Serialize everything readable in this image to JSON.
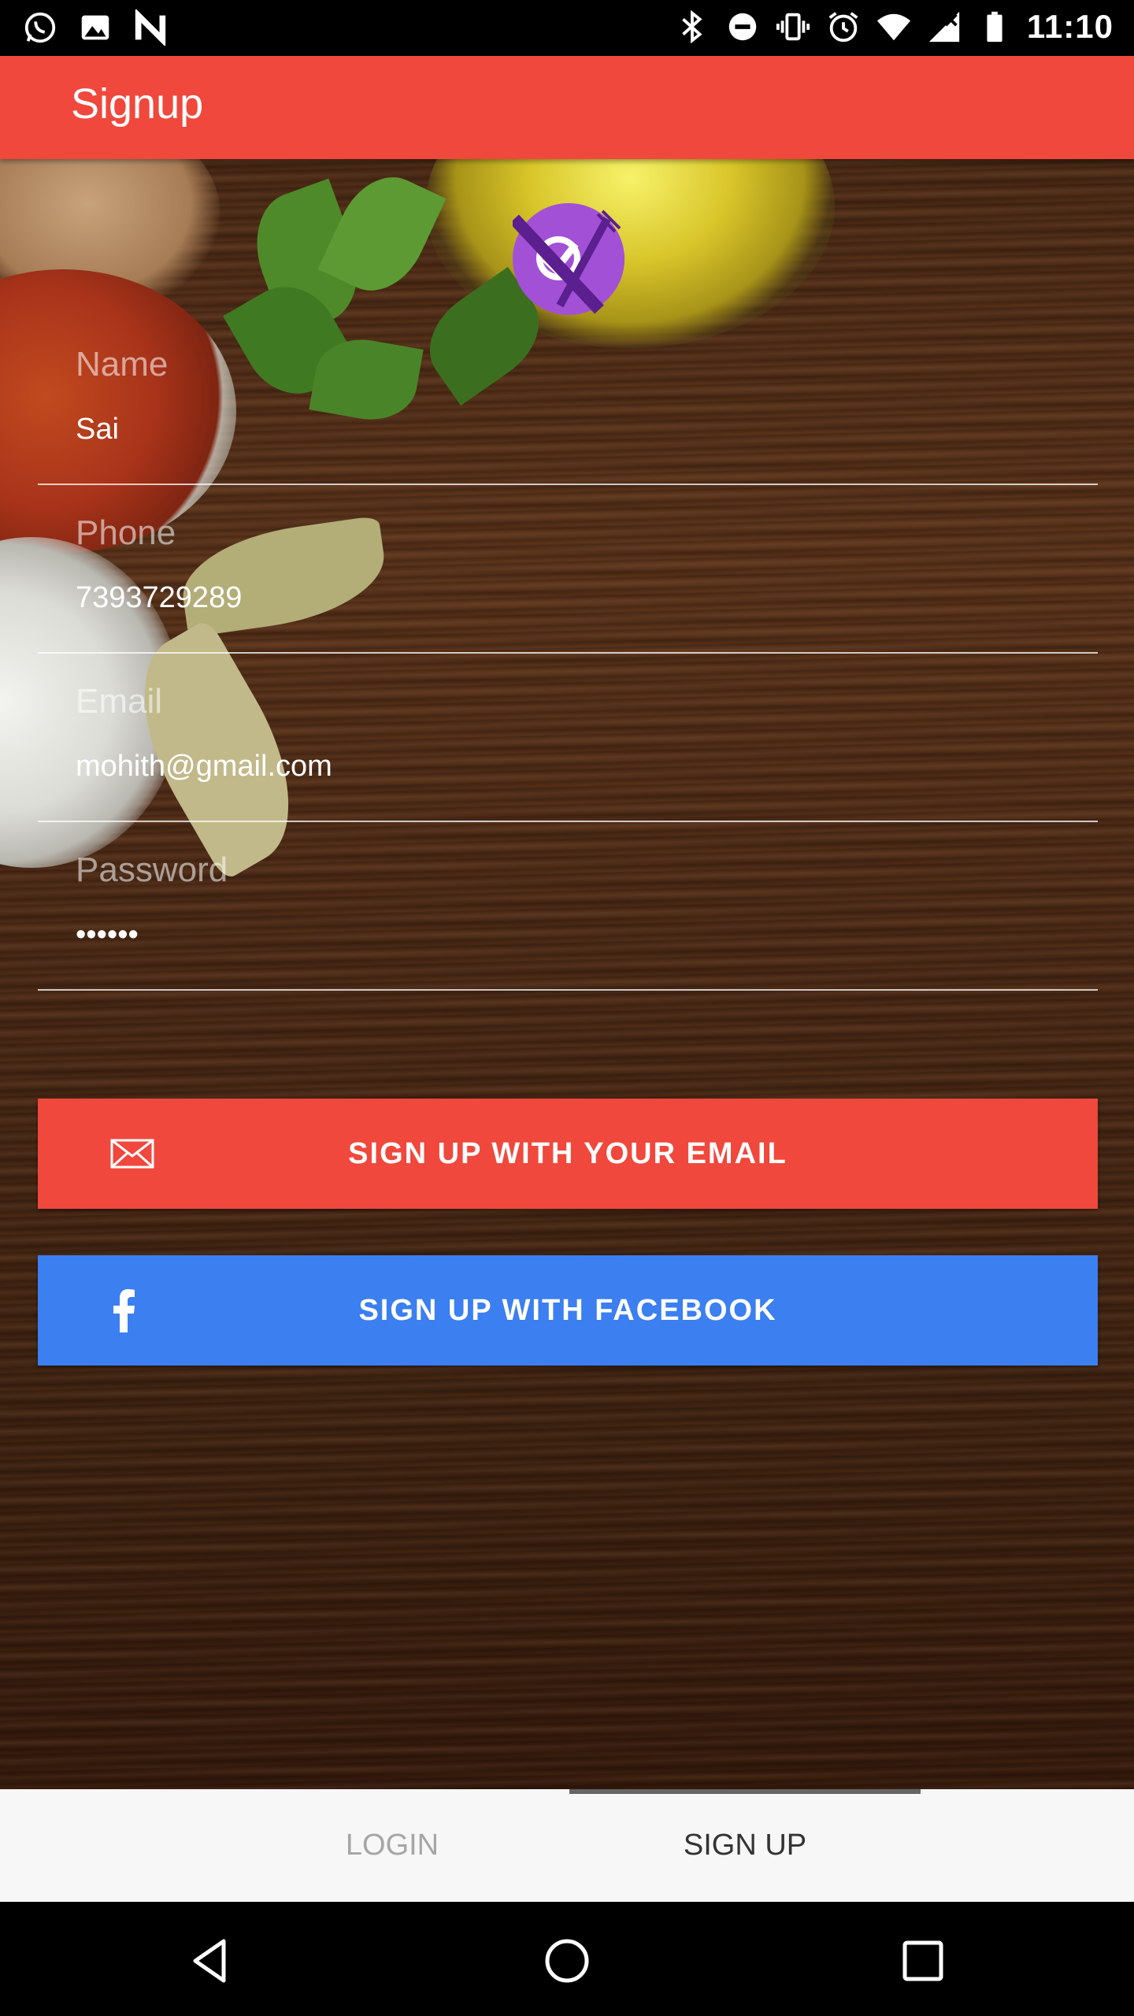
{
  "status_bar": {
    "time": "11:10",
    "left_icons": [
      "whatsapp-icon",
      "image-icon",
      "n-icon"
    ],
    "right_icons": [
      "bluetooth-icon",
      "do-not-disturb-icon",
      "vibrate-icon",
      "alarm-icon",
      "wifi-icon",
      "signal-icon",
      "battery-icon"
    ]
  },
  "app_bar": {
    "title": "Signup"
  },
  "form": {
    "name": {
      "label": "Name",
      "value": "Sai"
    },
    "phone": {
      "label": "Phone",
      "value": "7393729289"
    },
    "email": {
      "label": "Email",
      "value": "mohith@gmail.com"
    },
    "password": {
      "label": "Password",
      "value": "••••••"
    }
  },
  "buttons": {
    "email_signup": "SIGN UP WITH YOUR EMAIL",
    "facebook_signup": "SIGN UP WITH FACEBOOK"
  },
  "tabs": {
    "login": "LOGIN",
    "signup": "SIGN UP",
    "active": "signup"
  },
  "colors": {
    "primary": "#f0483d",
    "facebook": "#3b7ff0",
    "logo": "#9f4fd4"
  }
}
